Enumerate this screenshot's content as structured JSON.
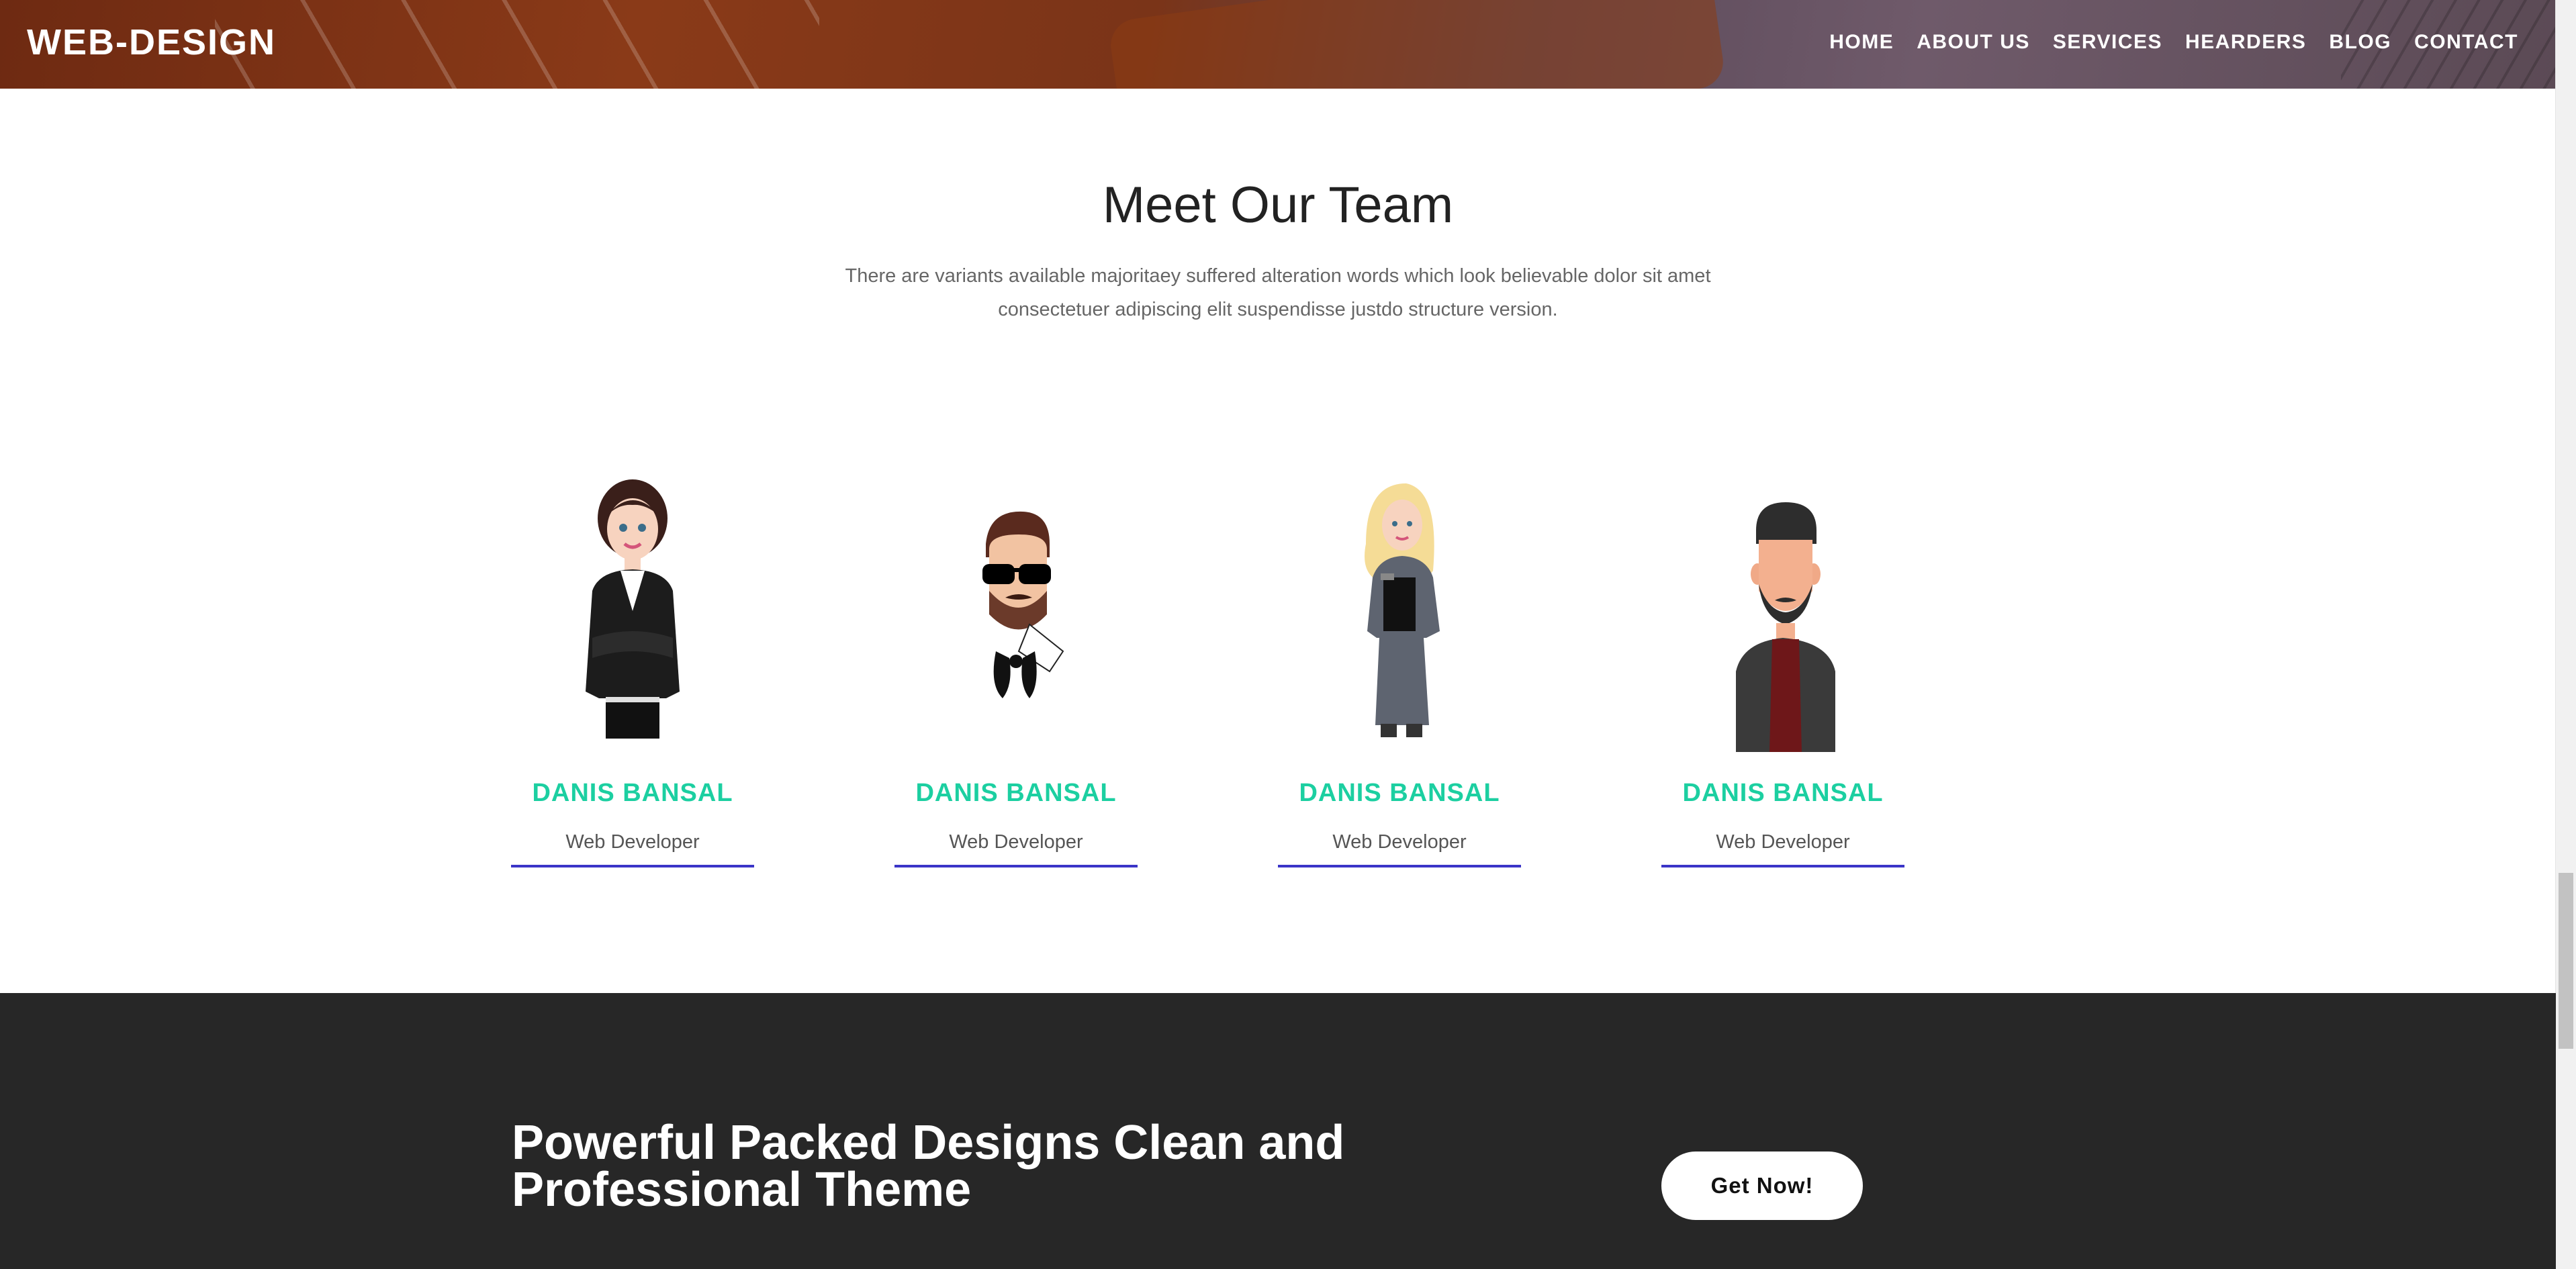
{
  "header": {
    "logo": "WEB-DESIGN",
    "nav": [
      "HOME",
      "ABOUT US",
      "SERVICES",
      "HEARDERS",
      "BLOG",
      "CONTACT"
    ]
  },
  "team": {
    "title": "Meet Our Team",
    "description": "There are variants available majoritaey suffered alteration words which look believable dolor sit amet consectetuer adipiscing elit suspendisse justdo structure version.",
    "members": [
      {
        "name": "DANIS BANSAL",
        "role": "Web Developer",
        "avatar": "businesswoman-avatar-icon"
      },
      {
        "name": "DANIS BANSAL",
        "role": "Web Developer",
        "avatar": "bearded-man-sunglasses-avatar-icon"
      },
      {
        "name": "DANIS BANSAL",
        "role": "Web Developer",
        "avatar": "blonde-woman-clipboard-avatar-icon"
      },
      {
        "name": "DANIS BANSAL",
        "role": "Web Developer",
        "avatar": "bearded-man-avatar-icon"
      }
    ]
  },
  "cta": {
    "title": "Powerful Packed Designs Clean and Professional Theme",
    "button": "Get Now!"
  },
  "colors": {
    "accent_name": "#1ccfa1",
    "underline": "#3b35c8",
    "cta_background": "#272727"
  }
}
